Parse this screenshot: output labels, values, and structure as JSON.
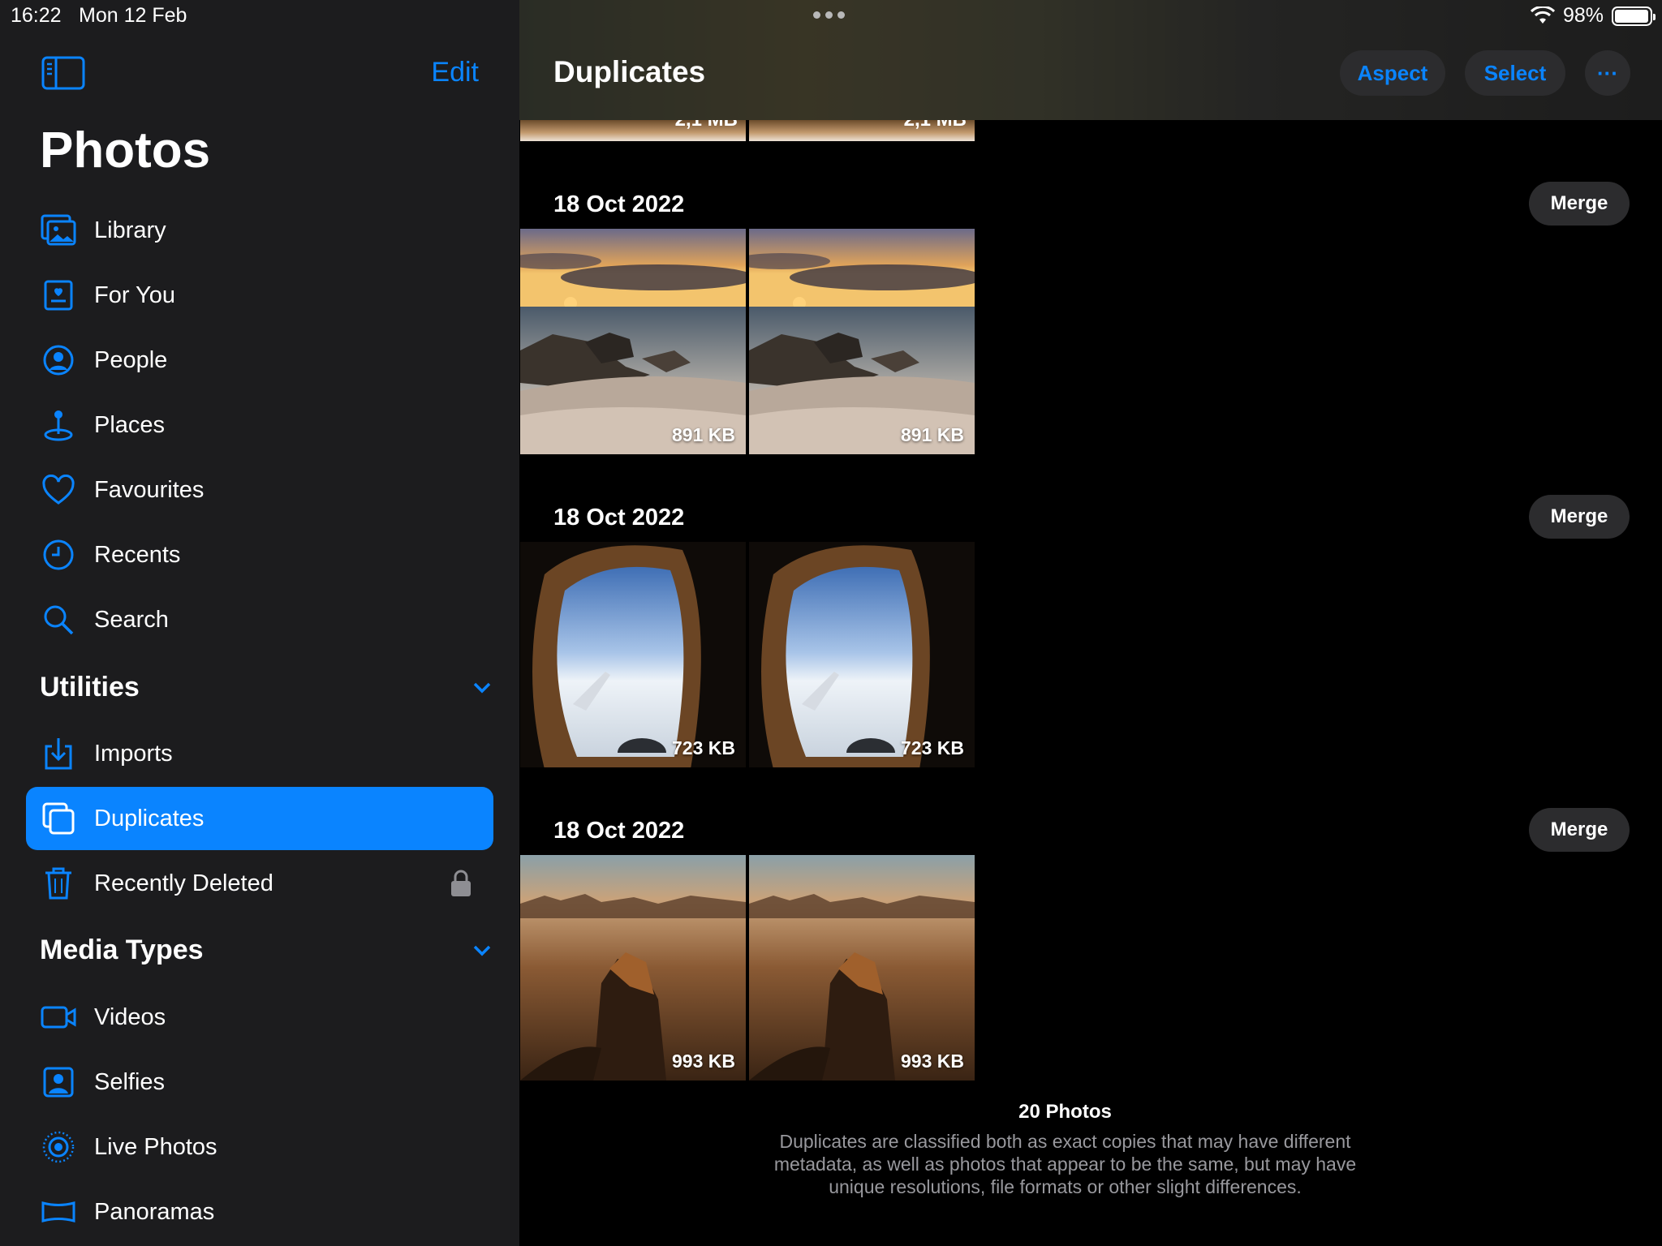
{
  "status_bar": {
    "time": "16:22",
    "date": "Mon 12 Feb",
    "battery_percent": "98%",
    "battery_level": 0.98
  },
  "sidebar": {
    "edit_label": "Edit",
    "title": "Photos",
    "items": [
      {
        "label": "Library",
        "icon": "photo-library-icon"
      },
      {
        "label": "For You",
        "icon": "for-you-icon"
      },
      {
        "label": "People",
        "icon": "person-circle-icon"
      },
      {
        "label": "Places",
        "icon": "map-pin-icon"
      },
      {
        "label": "Favourites",
        "icon": "heart-icon"
      },
      {
        "label": "Recents",
        "icon": "clock-icon"
      },
      {
        "label": "Search",
        "icon": "search-icon"
      }
    ],
    "utilities": {
      "header": "Utilities",
      "items": [
        {
          "label": "Imports",
          "icon": "import-icon"
        },
        {
          "label": "Duplicates",
          "icon": "duplicates-icon",
          "selected": true
        },
        {
          "label": "Recently Deleted",
          "icon": "trash-icon",
          "locked": true
        }
      ]
    },
    "media_types": {
      "header": "Media Types",
      "items": [
        {
          "label": "Videos",
          "icon": "video-icon"
        },
        {
          "label": "Selfies",
          "icon": "selfie-icon"
        },
        {
          "label": "Live Photos",
          "icon": "live-photo-icon"
        },
        {
          "label": "Panoramas",
          "icon": "panorama-icon"
        }
      ]
    }
  },
  "main": {
    "title": "Duplicates",
    "buttons": {
      "aspect": "Aspect",
      "select": "Select",
      "more": "···"
    },
    "top_partial_size": "2,1 MB",
    "groups": [
      {
        "date": "18 Oct 2022",
        "merge_label": "Merge",
        "photos": [
          {
            "size": "891 KB",
            "subject": "sunset-sea-rocks"
          },
          {
            "size": "891 KB",
            "subject": "sunset-sea-rocks"
          }
        ]
      },
      {
        "date": "18 Oct 2022",
        "merge_label": "Merge",
        "photos": [
          {
            "size": "723 KB",
            "subject": "airplane-window"
          },
          {
            "size": "723 KB",
            "subject": "airplane-window"
          }
        ]
      },
      {
        "date": "18 Oct 2022",
        "merge_label": "Merge",
        "photos": [
          {
            "size": "993 KB",
            "subject": "desert-rock-formation"
          },
          {
            "size": "993 KB",
            "subject": "desert-rock-formation"
          }
        ]
      }
    ],
    "footer": {
      "count": "20 Photos",
      "description": "Duplicates are classified both as exact copies that may have different metadata, as well as photos that appear to be the same, but may have unique resolutions, file formats or other slight differences."
    }
  },
  "colors": {
    "accent": "#0a84ff",
    "sidebar_bg": "#1c1c1e",
    "pill_bg": "#2c2c2e",
    "secondary_text": "#98989d"
  }
}
